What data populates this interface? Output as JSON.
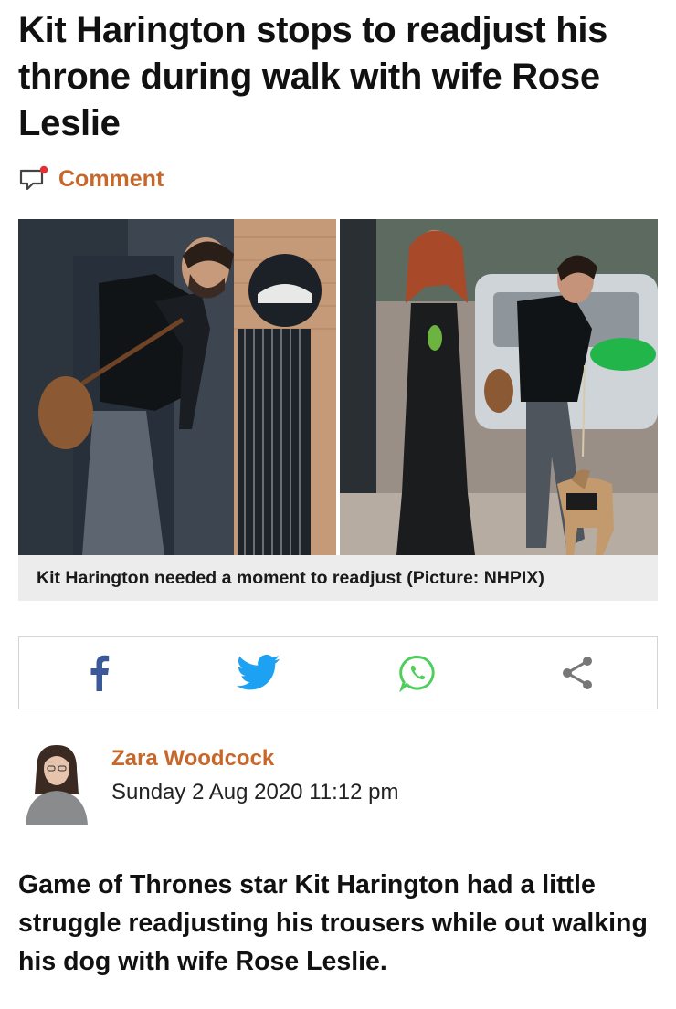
{
  "article": {
    "headline": "Kit Harington stops to readjust his throne during walk with wife Rose Leslie",
    "comment_label": "Comment",
    "image_caption": "Kit Harington needed a moment to readjust (Picture: NHPIX)",
    "lede": "Game of Thrones star Kit Harington had a little struggle readjusting his trousers while out walking his dog with wife Rose Leslie."
  },
  "author": {
    "name": "Zara Woodcock",
    "date": "Sunday 2 Aug 2020 11:12 pm"
  },
  "share": {
    "buttons": [
      {
        "icon": "facebook-icon",
        "color": "#3b5998"
      },
      {
        "icon": "twitter-icon",
        "color": "#1da1f2"
      },
      {
        "icon": "whatsapp-icon",
        "color": "#4fce5d"
      },
      {
        "icon": "share-icon",
        "color": "#777777"
      }
    ]
  },
  "theme": {
    "accent": "#c8672a",
    "caption_bg": "#ececec"
  }
}
